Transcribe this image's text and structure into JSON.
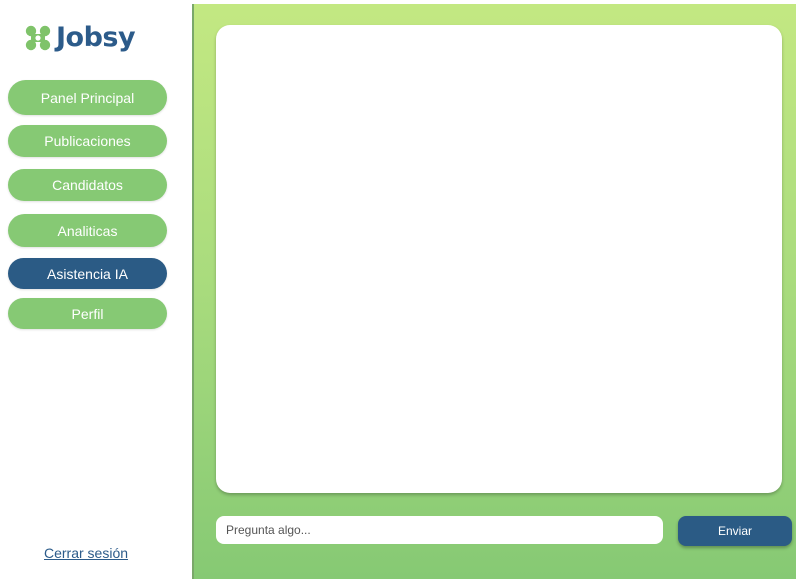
{
  "brand": {
    "name": "Jobsy",
    "color": "#2c5b8a",
    "accent": "#86c974"
  },
  "sidebar": {
    "items": [
      {
        "label": "Panel Principal",
        "active": false
      },
      {
        "label": "Publicaciones",
        "active": false
      },
      {
        "label": "Candidatos",
        "active": false
      },
      {
        "label": "Analiticas",
        "active": false
      },
      {
        "label": "Asistencia IA",
        "active": true
      },
      {
        "label": "Perfil",
        "active": false
      }
    ],
    "logout_label": "Cerrar sesión"
  },
  "chat": {
    "input_value": "",
    "input_placeholder": "Pregunta algo...",
    "send_label": "Enviar"
  }
}
